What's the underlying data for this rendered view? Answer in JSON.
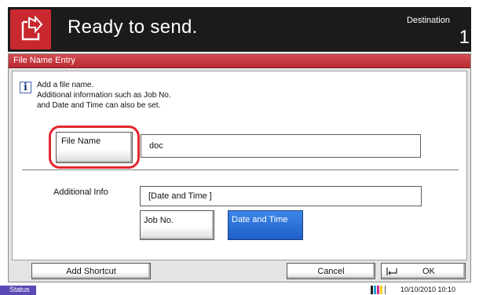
{
  "header": {
    "title": "Ready to send.",
    "destination_label": "Destination",
    "destination_count": "1"
  },
  "panel": {
    "title": "File Name Entry",
    "info_lines": [
      "Add a file name.",
      "Additional information such as Job No.",
      "and Date and Time can also be set."
    ],
    "file_name_button": "File Name",
    "file_name_value": "doc",
    "additional_info_label": "Additional Info",
    "additional_info_value": "[Date and Time ]",
    "job_no_button": "Job No.",
    "date_time_button": "Date and Time",
    "selected_option": "Date and Time"
  },
  "footer": {
    "add_shortcut": "Add Shortcut",
    "cancel": "Cancel",
    "ok": "OK"
  },
  "status_bar": {
    "status_label": "Status",
    "datetime": "10/10/2010  10:10",
    "toner_colors": [
      "#222222",
      "#1aa6d8",
      "#d8248a",
      "#f2d21a"
    ]
  },
  "colors": {
    "accent_red": "#c8282e",
    "selected_blue": "#2a6fd6",
    "status_purple": "#5c48b4"
  },
  "icons": {
    "home": "send-screen-icon",
    "info": "info-icon",
    "enter": "enter-arrow-icon",
    "toner": "toner-level-icon"
  }
}
